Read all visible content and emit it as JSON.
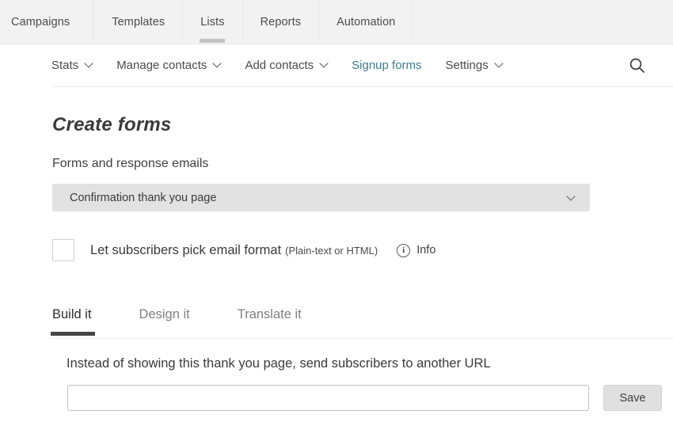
{
  "colors": {
    "link_teal": "#3f7c8c",
    "topnav_bg": "#f2f2f2",
    "select_bg": "#e2e2e2",
    "active_tab_underline": "#444444",
    "button_bg": "#e0e0e0"
  },
  "topnav": {
    "items": [
      {
        "label": "Campaigns",
        "active": false
      },
      {
        "label": "Templates",
        "active": false
      },
      {
        "label": "Lists",
        "active": true
      },
      {
        "label": "Reports",
        "active": false
      },
      {
        "label": "Automation",
        "active": false
      }
    ]
  },
  "subnav": {
    "items": [
      {
        "label": "Stats",
        "has_chevron": true,
        "is_link": false
      },
      {
        "label": "Manage contacts",
        "has_chevron": true,
        "is_link": false
      },
      {
        "label": "Add contacts",
        "has_chevron": true,
        "is_link": false
      },
      {
        "label": "Signup forms",
        "has_chevron": false,
        "is_link": true
      },
      {
        "label": "Settings",
        "has_chevron": true,
        "is_link": false
      }
    ],
    "search_icon": "search-icon"
  },
  "main": {
    "page_title": "Create forms",
    "section_label": "Forms and response emails",
    "form_select": {
      "value": "Confirmation thank you page",
      "chevron_icon": "chevron-down-icon"
    },
    "email_format": {
      "checked": false,
      "label": "Let subscribers pick email format",
      "sub_label": "(Plain-text or HTML)",
      "info_icon": "info-icon",
      "info_label": "Info"
    },
    "tabs": [
      {
        "label": "Build it",
        "active": true
      },
      {
        "label": "Design it",
        "active": false
      },
      {
        "label": "Translate it",
        "active": false
      }
    ],
    "url_section": {
      "label": "Instead of showing this thank you page, send subscribers to another URL",
      "input_value": "",
      "input_placeholder": "",
      "save_label": "Save"
    }
  }
}
